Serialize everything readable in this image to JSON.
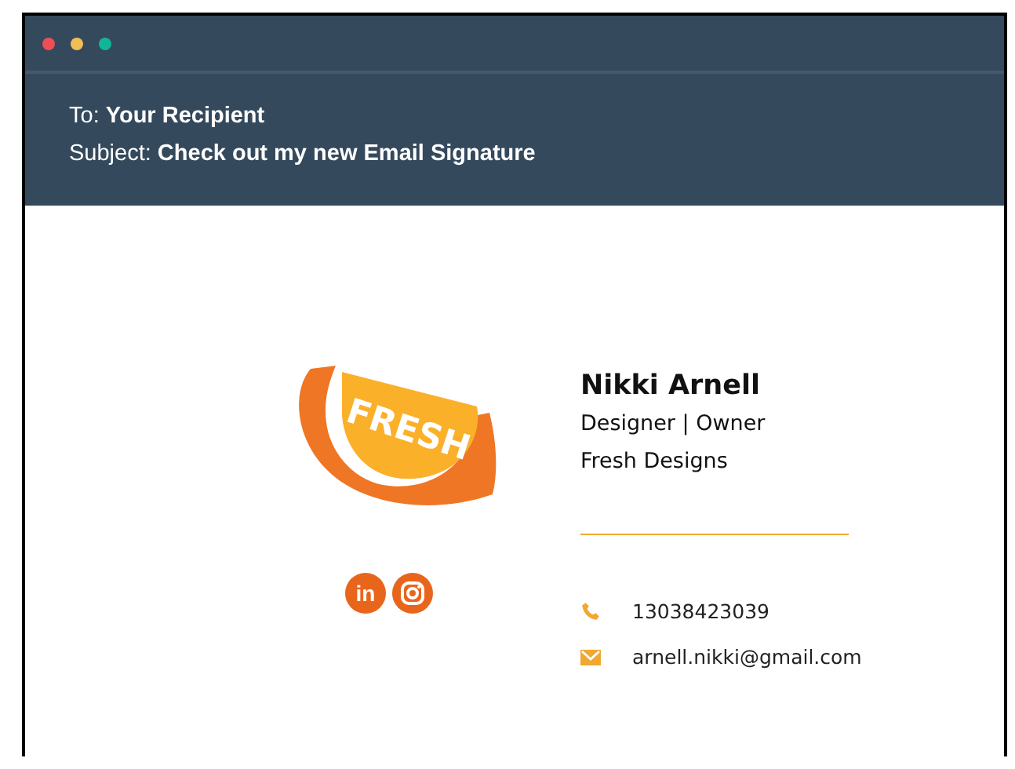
{
  "window": {
    "controls": [
      {
        "color": "#ee4f55"
      },
      {
        "color": "#f2bd57"
      },
      {
        "color": "#13b596"
      }
    ]
  },
  "email": {
    "to": "To: **Your Recipient**",
    "subject": "Subject: **Check out my new Email Signature**"
  },
  "signature": {
    "logo": {
      "text": "FRESH"
    },
    "social": [
      {
        "kind": "linkedin",
        "label": "in"
      },
      {
        "kind": "instagram"
      }
    ],
    "name": "Nikki Arnell",
    "role": "Designer | Owner",
    "company": "Fresh Designs",
    "contacts": [
      {
        "kind": "phone",
        "value": "13038423039"
      },
      {
        "kind": "email",
        "value": "arnell.nikki@gmail.com"
      }
    ]
  }
}
